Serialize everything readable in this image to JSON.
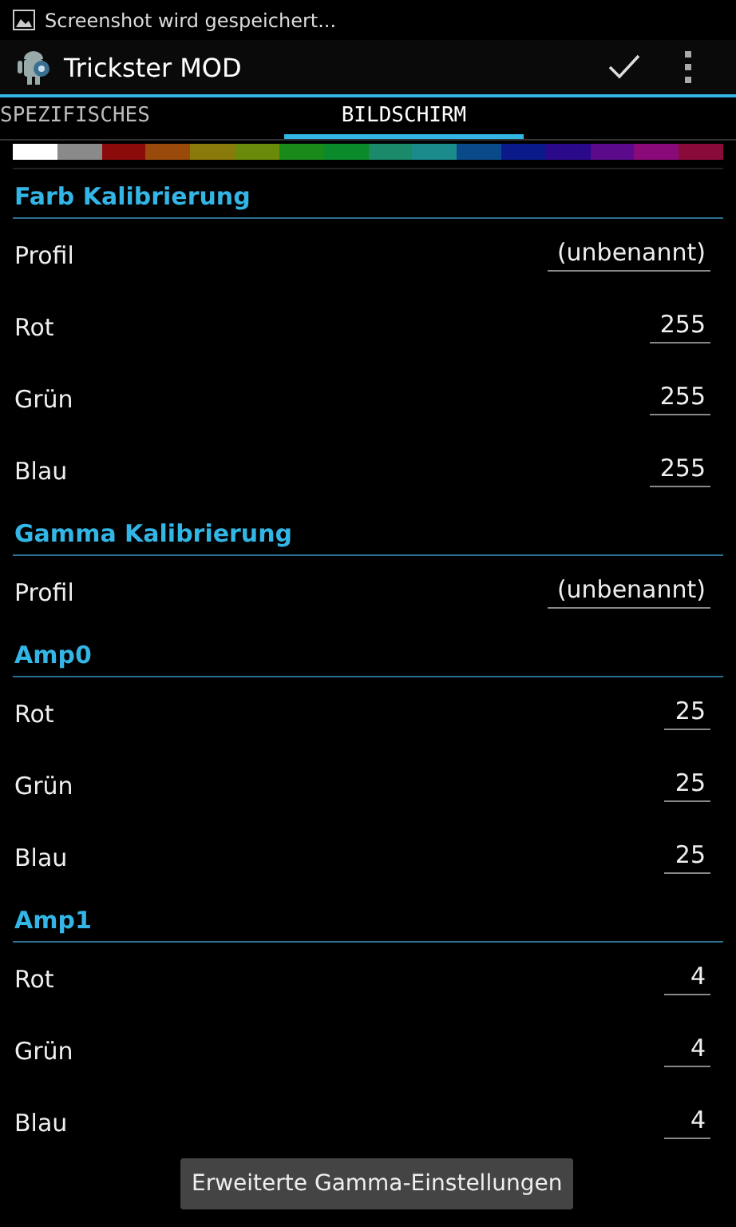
{
  "status_bar": {
    "notification": "Screenshot wird gespeichert..."
  },
  "action_bar": {
    "title": "Trickster MOD"
  },
  "tabs": [
    {
      "label": "SPEZIFISCHES",
      "selected": false
    },
    {
      "label": "BILDSCHIRM",
      "selected": true
    }
  ],
  "swatches": [
    {
      "color": "#ffffff"
    },
    {
      "color": "#8a8a8a"
    },
    {
      "color": "#8b0a0a"
    },
    {
      "color": "#9a4a0a"
    },
    {
      "color": "#8a7a0a"
    },
    {
      "color": "#6a8a0a"
    },
    {
      "color": "#1a8a1a"
    },
    {
      "color": "#0a8a2a"
    },
    {
      "color": "#1a8a6a"
    },
    {
      "color": "#1a8a8a"
    },
    {
      "color": "#0a4a8a"
    },
    {
      "color": "#0a1a8a"
    },
    {
      "color": "#2a0a8a"
    },
    {
      "color": "#5a0a8a"
    },
    {
      "color": "#8a0a7a"
    },
    {
      "color": "#8a0a3a"
    }
  ],
  "sections": [
    {
      "title": "Farb Kalibrierung",
      "rows": [
        {
          "label": "Profil",
          "value": "(unbenannt)"
        },
        {
          "label": "Rot",
          "value": "255"
        },
        {
          "label": "Grün",
          "value": "255"
        },
        {
          "label": "Blau",
          "value": "255"
        }
      ]
    },
    {
      "title": "Gamma Kalibrierung",
      "rows": [
        {
          "label": "Profil",
          "value": "(unbenannt)"
        }
      ]
    },
    {
      "title": "Amp0",
      "rows": [
        {
          "label": "Rot",
          "value": "25"
        },
        {
          "label": "Grün",
          "value": "25"
        },
        {
          "label": "Blau",
          "value": "25"
        }
      ]
    },
    {
      "title": "Amp1",
      "rows": [
        {
          "label": "Rot",
          "value": "4"
        },
        {
          "label": "Grün",
          "value": "4"
        },
        {
          "label": "Blau",
          "value": "4"
        }
      ]
    }
  ],
  "toast": "Erweiterte Gamma-Einstellungen"
}
